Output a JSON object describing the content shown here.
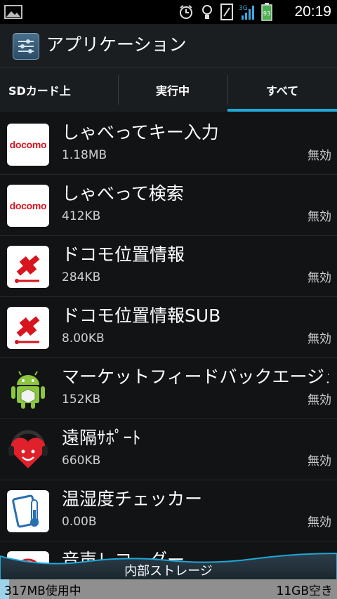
{
  "status_bar": {
    "time": "20:19",
    "network": "3G",
    "battery": "93",
    "icons": [
      "gallery-icon",
      "alarm-icon",
      "screen-icon",
      "sync-icon",
      "signal-icon",
      "battery-icon"
    ]
  },
  "action_bar": {
    "title": "アプリケーション",
    "icon": "settings-sliders-icon"
  },
  "tabs": [
    {
      "label": "SDカード上",
      "selected": false
    },
    {
      "label": "実行中",
      "selected": false
    },
    {
      "label": "すべて",
      "selected": true
    }
  ],
  "apps": [
    {
      "name": "しゃべってキー入力",
      "size": "1.18MB",
      "status": "無効",
      "icon": "docomo-logo-icon",
      "logo_text": "docomo"
    },
    {
      "name": "しゃべって検索",
      "size": "412KB",
      "status": "無効",
      "icon": "docomo-logo-icon",
      "logo_text": "docomo"
    },
    {
      "name": "ドコモ位置情報",
      "size": "284KB",
      "status": "無効",
      "icon": "satellite-location-icon"
    },
    {
      "name": "ドコモ位置情報SUB",
      "size": "8.00KB",
      "status": "無効",
      "icon": "satellite-location-icon"
    },
    {
      "name": "マーケットフィードバックエージェ",
      "size": "152KB",
      "status": "無効",
      "icon": "android-robot-icon"
    },
    {
      "name": "遠隔ｻﾎﾟｰﾄ",
      "size": "660KB",
      "status": "無効",
      "icon": "heart-headset-icon"
    },
    {
      "name": "温湿度チェッカー",
      "size": "0.00B",
      "status": "無効",
      "icon": "thermometer-icon"
    },
    {
      "name": "音声レコーダー",
      "icon": "recorder-icon"
    }
  ],
  "storage": {
    "label": "内部ストレージ",
    "used": "317MB使用中",
    "free": "11GB空き",
    "used_fraction": 0.028,
    "used_color": "#9fd3ea",
    "free_color": "#8f8f8f"
  },
  "colors": {
    "accent": "#1ea7d8",
    "background": "#111315"
  }
}
